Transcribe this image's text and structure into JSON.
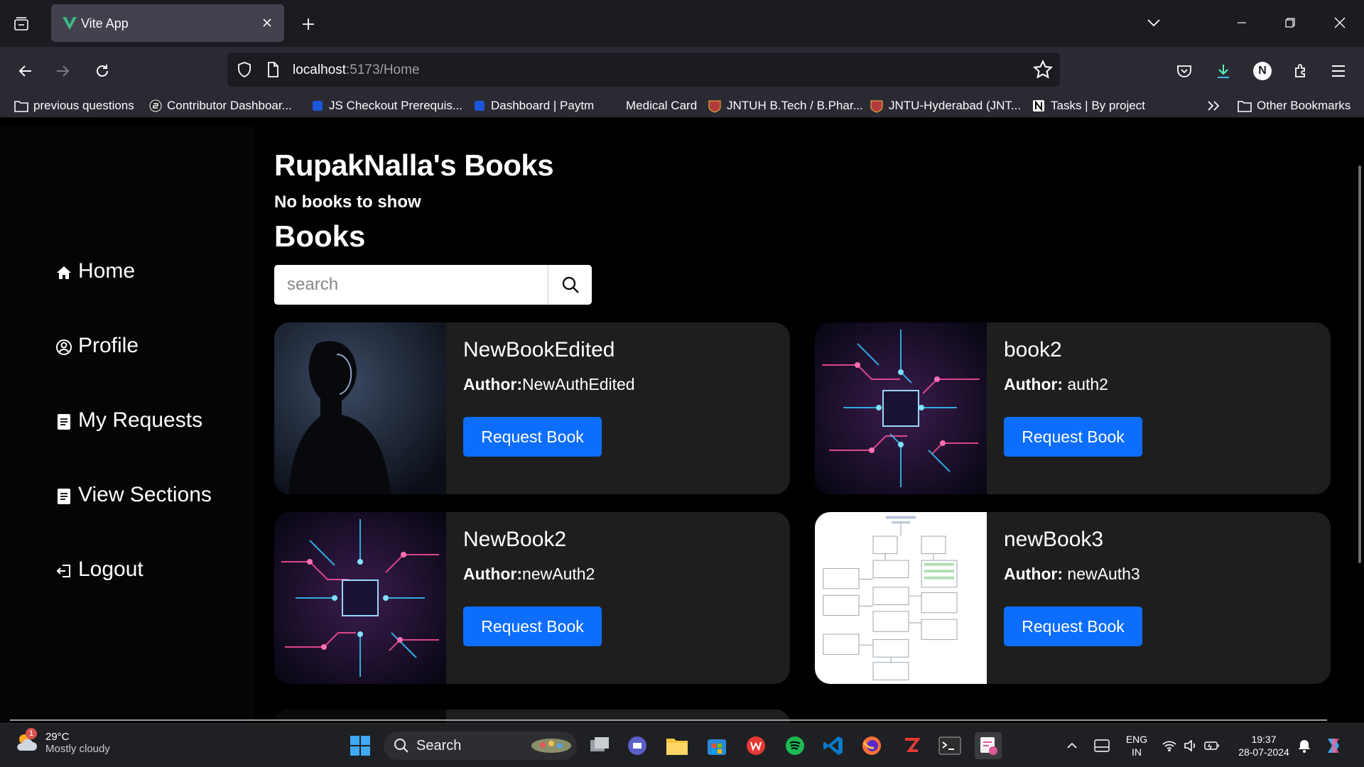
{
  "browser": {
    "tab_title": "Vite App",
    "url_host": "localhost",
    "url_rest": ":5173/Home",
    "bookmarks": [
      {
        "label": "previous questions",
        "icon": "folder-icon"
      },
      {
        "label": "Contributor Dashboar...",
        "icon": "site-icon"
      },
      {
        "label": "JS Checkout Prerequis...",
        "icon": "site-icon"
      },
      {
        "label": "Dashboard | Paytm",
        "icon": "site-icon"
      },
      {
        "label": "Medical Card",
        "icon": "site-icon"
      },
      {
        "label": "JNTUH B.Tech / B.Phar...",
        "icon": "site-icon"
      },
      {
        "label": "JNTU-Hyderabad (JNT...",
        "icon": "site-icon"
      },
      {
        "label": "Tasks | By project",
        "icon": "notion-icon"
      }
    ],
    "other_bookmarks": "Other Bookmarks",
    "profile_initial": "N"
  },
  "sidebar": {
    "items": [
      {
        "label": "Home",
        "icon": "home-icon"
      },
      {
        "label": "Profile",
        "icon": "user-circle-icon"
      },
      {
        "label": "My Requests",
        "icon": "document-icon"
      },
      {
        "label": "View Sections",
        "icon": "document-icon"
      },
      {
        "label": "Logout",
        "icon": "logout-icon"
      }
    ]
  },
  "main": {
    "user_heading": "RupakNalla's Books",
    "no_books": "No books to show",
    "books_heading": "Books",
    "search_placeholder": "search",
    "author_label": "Author:",
    "books": [
      {
        "name": "NewBookEdited",
        "author": "NewAuthEdited",
        "button": "Request Book"
      },
      {
        "name": "book2",
        "author": " auth2",
        "button": "Request Book"
      },
      {
        "name": "NewBook2",
        "author": "newAuth2",
        "button": "Request Book"
      },
      {
        "name": "newBook3",
        "author": " newAuth3",
        "button": "Request Book"
      }
    ]
  },
  "taskbar": {
    "temperature": "29°C",
    "weather": "Mostly cloudy",
    "weather_badge": "1",
    "search_label": "Search",
    "lang1": "ENG",
    "lang2": "IN",
    "time": "19:37",
    "date": "28-07-2024"
  },
  "colors": {
    "accent": "#0d6efd",
    "card_bg": "#1e1e1e",
    "chrome_dark": "#1c1b22",
    "chrome_mid": "#2b2a33"
  }
}
